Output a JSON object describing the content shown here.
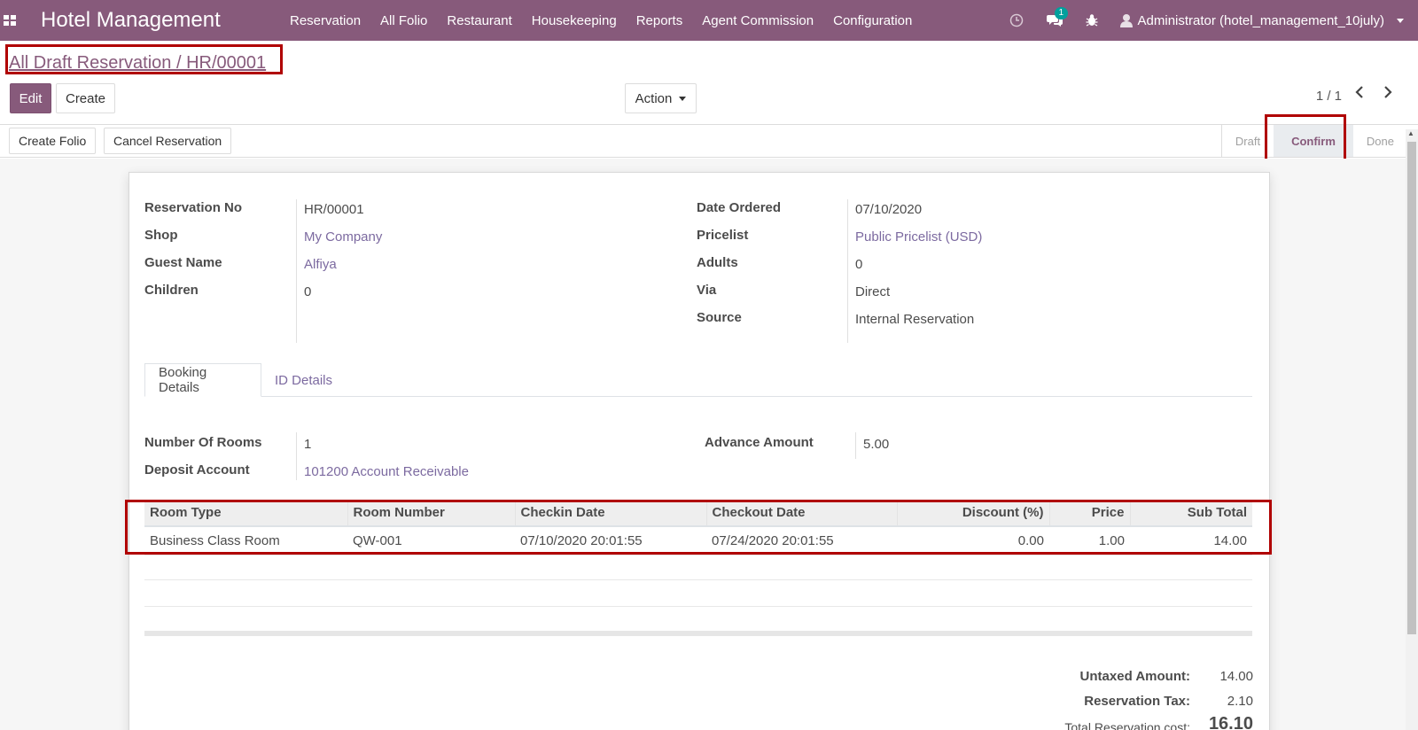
{
  "navbar": {
    "brand": "Hotel Management",
    "menu": [
      "Reservation",
      "All Folio",
      "Restaurant",
      "Housekeeping",
      "Reports",
      "Agent Commission",
      "Configuration"
    ],
    "chat_badge": "1",
    "user": "Administrator (hotel_management_10july)",
    "bg_color": "#875a7b"
  },
  "breadcrumb": "All Draft Reservation / HR/00001",
  "control": {
    "edit": "Edit",
    "create": "Create",
    "action": "Action",
    "pager": "1 / 1"
  },
  "statusbar": {
    "buttons": [
      "Create Folio",
      "Cancel Reservation"
    ],
    "states": [
      "Draft",
      "Confirm",
      "Done"
    ],
    "active_state": "Confirm"
  },
  "form": {
    "left": [
      {
        "label": "Reservation No",
        "value": "HR/00001"
      },
      {
        "label": "Shop",
        "value": "My Company"
      },
      {
        "label": "Guest Name",
        "value": "Alfiya"
      },
      {
        "label": "Children",
        "value": "0"
      }
    ],
    "right": [
      {
        "label": "Date Ordered",
        "value": "07/10/2020"
      },
      {
        "label": "Pricelist",
        "value": "Public Pricelist (USD)"
      },
      {
        "label": "Adults",
        "value": "0"
      },
      {
        "label": "Via",
        "value": "Direct"
      },
      {
        "label": "Source",
        "value": "Internal Reservation"
      }
    ]
  },
  "tabs": [
    "Booking Details",
    "ID Details"
  ],
  "booking": {
    "rooms_label": "Number Of Rooms",
    "rooms_value": "1",
    "deposit_label": "Deposit Account",
    "deposit_value": "101200 Account Receivable",
    "advance_label": "Advance Amount",
    "advance_value": "5.00"
  },
  "lines": {
    "columns": [
      "Room Type",
      "Room Number",
      "Checkin Date",
      "Checkout Date",
      "Discount (%)",
      "Price",
      "Sub Total"
    ],
    "rows": [
      [
        "Business Class Room",
        "QW-001",
        "07/10/2020 20:01:55",
        "07/24/2020 20:01:55",
        "0.00",
        "1.00",
        "14.00"
      ]
    ]
  },
  "totals": [
    {
      "label": "Untaxed Amount:",
      "value": "14.00"
    },
    {
      "label": "Reservation Tax:",
      "value": "2.10"
    },
    {
      "label": "Total Reservation cost:",
      "value": "16.10"
    }
  ]
}
